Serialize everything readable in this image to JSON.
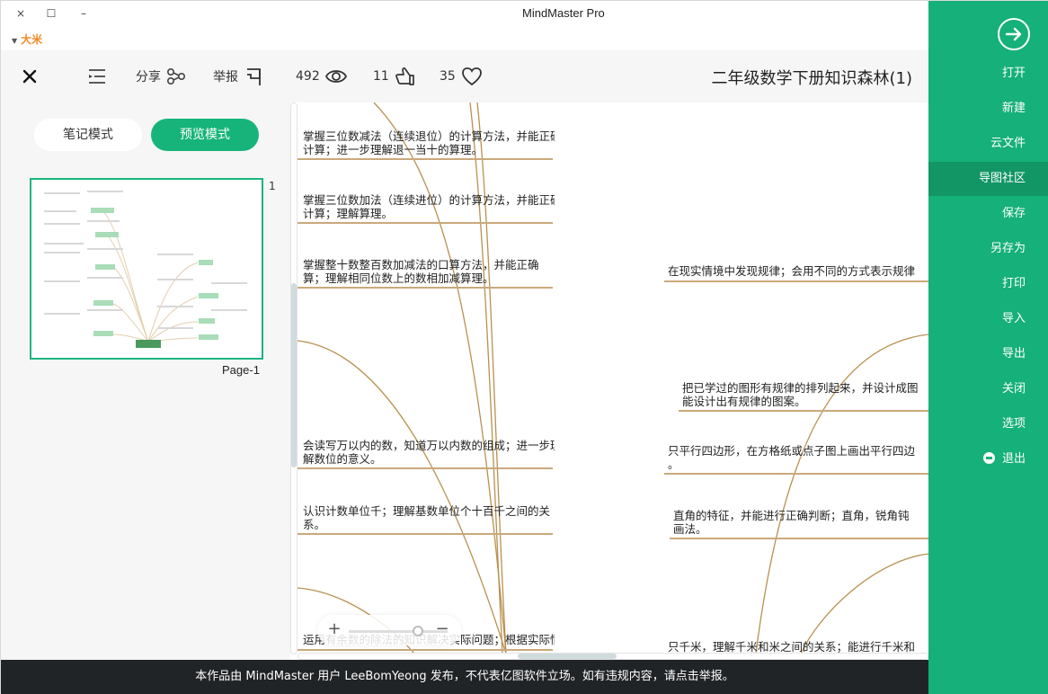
{
  "window": {
    "app_title": "MindMaster Pro",
    "close_glyph": "×",
    "maximize_glyph": "☐",
    "minimize_glyph": "–",
    "user_name": "大米"
  },
  "toolbar": {
    "doc_title": "二年级数学下册知识森林(1)",
    "favorite_count": "35",
    "like_count": "11",
    "view_count": "492",
    "report_label": "举报",
    "share_label": "分享"
  },
  "left_panel": {
    "preview_mode_label": "预览模式",
    "note_mode_label": "笔记模式",
    "page_number": "1",
    "page_label": "Page-1"
  },
  "canvas": {
    "nodes_left": [
      {
        "line1": "掌握三位数减法（连续退位）的计算方法，并能正确",
        "line2": "计算；进一步理解退一当十的算理。"
      },
      {
        "line1": "掌握三位数加法（连续进位）的计算方法，并能正确",
        "line2": "计算；理解算理。"
      },
      {
        "line1": "掌握整十数整百数加减法的口算方法，并能正确",
        "line2": "算；理解相同位数上的数相加减算理。"
      },
      {
        "line1": "会读写万以内的数，知道万以内数的组成；进一步理",
        "line2": "解数位的意义。"
      },
      {
        "line1": "认识计数单位千；理解基数单位个十百千之间的关",
        "line2": "系。"
      },
      {
        "line1": "运用有余数的除法的知识解决实际问题；根据实际情",
        "line2": ""
      }
    ],
    "nodes_right": [
      {
        "line1": "在现实情境中发现规律；会用不同的方式表示规律",
        "line2": ""
      },
      {
        "line1": "把已学过的图形有规律的排列起来，并设计成图",
        "line2": "能设计出有规律的图案。"
      },
      {
        "line1": "只平行四边形，在方格纸或点子图上画出平行四边",
        "line2": "。"
      },
      {
        "line1": "直角的特征，并能进行正确判断；直角，锐角钝",
        "line2": "画法。"
      },
      {
        "line1": "只千米，理解千米和米之间的关系；能进行千米和",
        "line2": ""
      }
    ],
    "zoom_in_label": "+",
    "zoom_out_label": "−",
    "zoom_level": 0.7
  },
  "footer": {
    "notice": "本作品由 MindMaster 用户 LeeBomYeong 发布，不代表亿图软件立场。如有违规内容，请点击举报。"
  },
  "side_menu": {
    "items": [
      {
        "label": "打开",
        "active": false
      },
      {
        "label": "新建",
        "active": false
      },
      {
        "label": "云文件",
        "active": false
      },
      {
        "label": "导图社区",
        "active": true
      },
      {
        "label": "保存",
        "active": false
      },
      {
        "label": "另存为",
        "active": false
      },
      {
        "label": "打印",
        "active": false
      },
      {
        "label": "导入",
        "active": false
      },
      {
        "label": "导出",
        "active": false
      },
      {
        "label": "关闭",
        "active": false
      },
      {
        "label": "选项",
        "active": false
      },
      {
        "label": "退出",
        "active": false
      }
    ]
  },
  "colors": {
    "brand_green": "#16b07a",
    "active_green": "#129666",
    "link_brown": "#c9a97a",
    "user_orange": "#f08a24",
    "footer_bg": "#212426"
  }
}
